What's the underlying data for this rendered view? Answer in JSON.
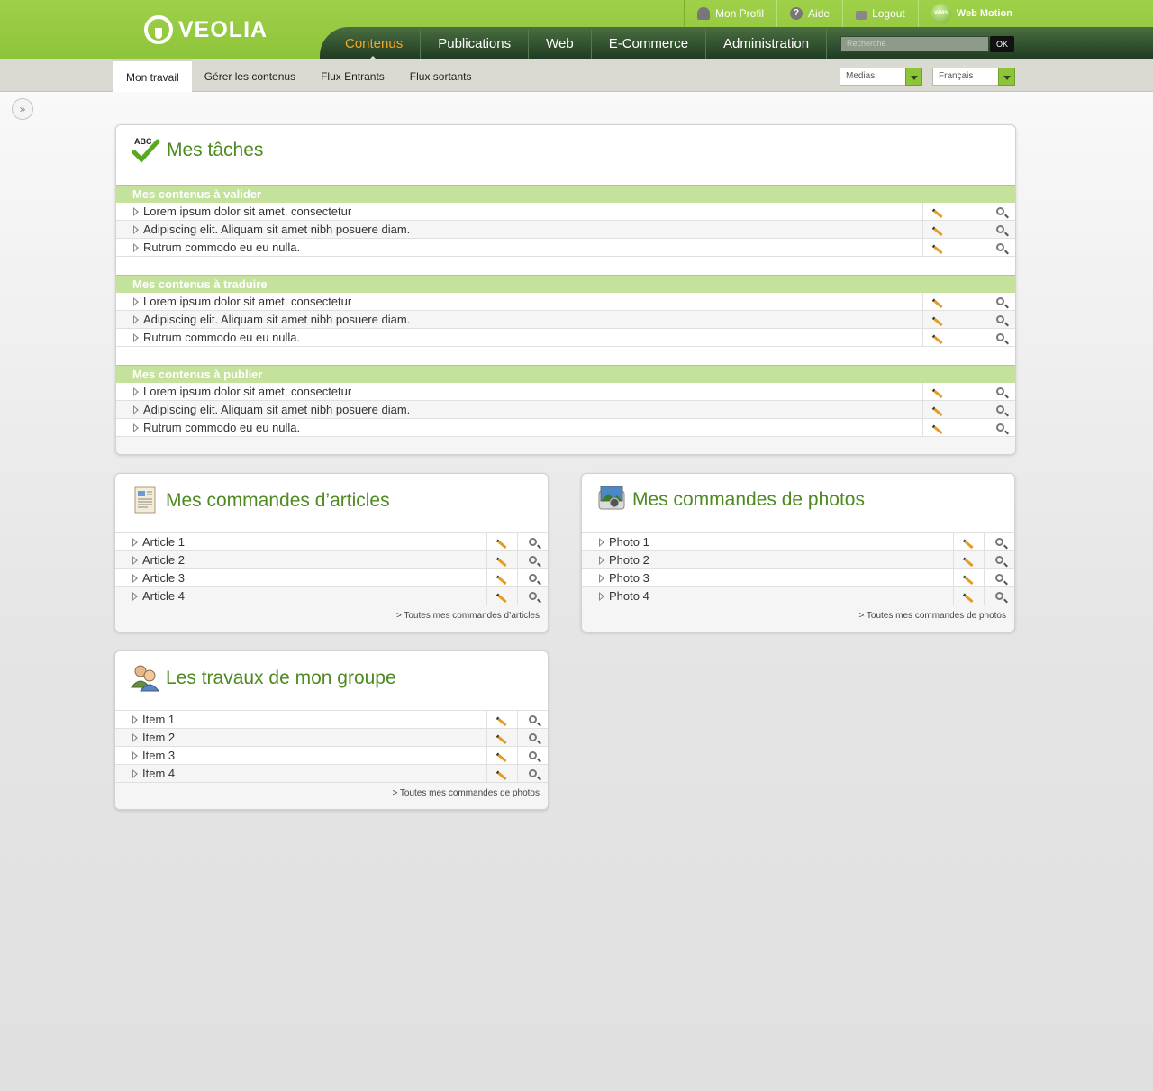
{
  "header": {
    "logo_text": "VEOLIA",
    "top_links": [
      {
        "label": "Mon Profil",
        "icon": "user-icon"
      },
      {
        "label": "Aide",
        "icon": "help-icon"
      },
      {
        "label": "Logout",
        "icon": "lock-icon"
      },
      {
        "label": "Web Motion",
        "icon": "web-motion-logo-icon"
      }
    ],
    "wm_badge": "WMS",
    "main_nav": [
      "Contenus",
      "Publications",
      "Web",
      "E-Commerce",
      "Administration"
    ],
    "active_main": "Contenus",
    "search": {
      "placeholder": "Recherche",
      "button": "OK"
    }
  },
  "subnav": {
    "items": [
      "Mon travail",
      "Gérer les contenus",
      "Flux Entrants",
      "Flux sortants"
    ],
    "active": "Mon travail",
    "selects": {
      "medias": "Medias",
      "langue": "Français"
    }
  },
  "colors": {
    "brand_green": "#8dc43a",
    "dark_green": "#1f3a22",
    "active_orange": "#f5a623",
    "title_green": "#4d8a1f",
    "section_green": "#c5e29c"
  },
  "taches": {
    "title": "Mes tâches",
    "icon": "abc-check-icon",
    "sections": [
      {
        "label": "Mes contenus à valider",
        "items": [
          "Lorem ipsum dolor sit amet, consectetur",
          "Adipiscing elit. Aliquam sit amet nibh posuere diam.",
          "Rutrum commodo eu eu nulla."
        ]
      },
      {
        "label": "Mes contenus à traduire",
        "items": [
          "Lorem ipsum dolor sit amet, consectetur",
          "Adipiscing elit. Aliquam sit amet nibh posuere diam.",
          "Rutrum commodo eu eu nulla."
        ]
      },
      {
        "label": "Mes contenus à publier",
        "items": [
          "Lorem ipsum dolor sit amet, consectetur",
          "Adipiscing elit. Aliquam sit amet nibh posuere diam.",
          "Rutrum commodo eu eu nulla."
        ]
      }
    ]
  },
  "articles": {
    "title": "Mes commandes d’articles",
    "icon": "document-icon",
    "items": [
      "Article 1",
      "Article 2",
      "Article 3",
      "Article 4"
    ],
    "more": "> Toutes mes commandes d’articles"
  },
  "photos": {
    "title": "Mes commandes de photos",
    "icon": "photo-icon",
    "items": [
      "Photo 1",
      "Photo 2",
      "Photo 3",
      "Photo 4"
    ],
    "more": "> Toutes mes commandes de photos"
  },
  "groupe": {
    "title": "Les travaux de mon groupe",
    "icon": "group-users-icon",
    "items": [
      "Item 1",
      "Item 2",
      "Item 3",
      "Item 4"
    ],
    "more": "> Toutes mes commandes de photos"
  }
}
